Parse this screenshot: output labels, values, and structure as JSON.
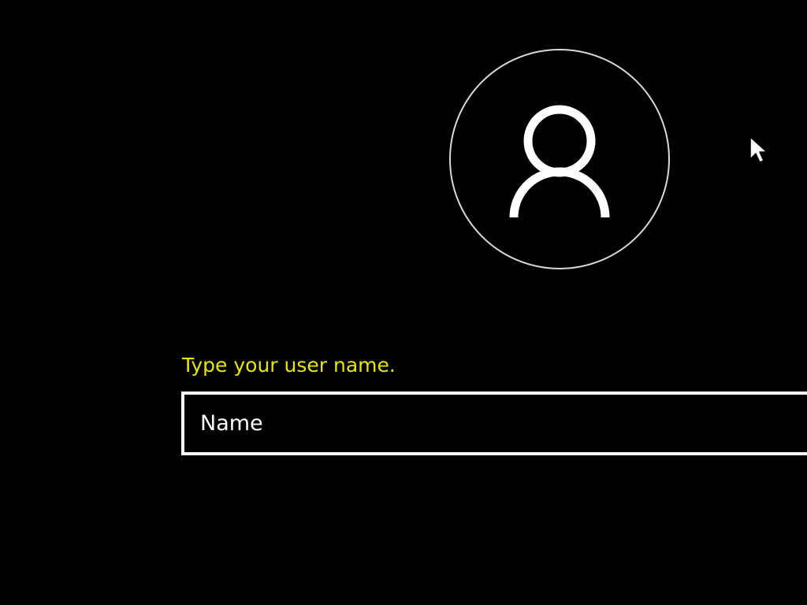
{
  "avatar": {
    "icon": "user-icon"
  },
  "cursor": {
    "icon": "mouse-pointer-icon"
  },
  "login": {
    "prompt": "Type your user name.",
    "name_placeholder": "Name",
    "name_value": ""
  },
  "colors": {
    "background": "#000000",
    "prompt": "#e6e600",
    "field_border": "#ffffff",
    "avatar_stroke": "#ffffff"
  }
}
